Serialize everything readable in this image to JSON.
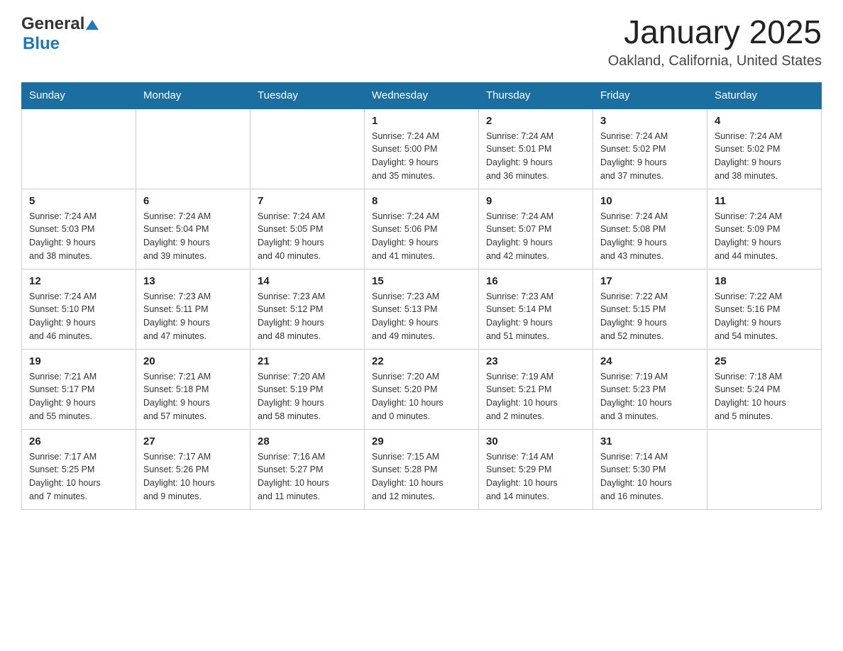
{
  "header": {
    "logo_general": "General",
    "logo_blue": "Blue",
    "title": "January 2025",
    "subtitle": "Oakland, California, United States"
  },
  "weekdays": [
    "Sunday",
    "Monday",
    "Tuesday",
    "Wednesday",
    "Thursday",
    "Friday",
    "Saturday"
  ],
  "weeks": [
    [
      {
        "day": "",
        "info": ""
      },
      {
        "day": "",
        "info": ""
      },
      {
        "day": "",
        "info": ""
      },
      {
        "day": "1",
        "info": "Sunrise: 7:24 AM\nSunset: 5:00 PM\nDaylight: 9 hours\nand 35 minutes."
      },
      {
        "day": "2",
        "info": "Sunrise: 7:24 AM\nSunset: 5:01 PM\nDaylight: 9 hours\nand 36 minutes."
      },
      {
        "day": "3",
        "info": "Sunrise: 7:24 AM\nSunset: 5:02 PM\nDaylight: 9 hours\nand 37 minutes."
      },
      {
        "day": "4",
        "info": "Sunrise: 7:24 AM\nSunset: 5:02 PM\nDaylight: 9 hours\nand 38 minutes."
      }
    ],
    [
      {
        "day": "5",
        "info": "Sunrise: 7:24 AM\nSunset: 5:03 PM\nDaylight: 9 hours\nand 38 minutes."
      },
      {
        "day": "6",
        "info": "Sunrise: 7:24 AM\nSunset: 5:04 PM\nDaylight: 9 hours\nand 39 minutes."
      },
      {
        "day": "7",
        "info": "Sunrise: 7:24 AM\nSunset: 5:05 PM\nDaylight: 9 hours\nand 40 minutes."
      },
      {
        "day": "8",
        "info": "Sunrise: 7:24 AM\nSunset: 5:06 PM\nDaylight: 9 hours\nand 41 minutes."
      },
      {
        "day": "9",
        "info": "Sunrise: 7:24 AM\nSunset: 5:07 PM\nDaylight: 9 hours\nand 42 minutes."
      },
      {
        "day": "10",
        "info": "Sunrise: 7:24 AM\nSunset: 5:08 PM\nDaylight: 9 hours\nand 43 minutes."
      },
      {
        "day": "11",
        "info": "Sunrise: 7:24 AM\nSunset: 5:09 PM\nDaylight: 9 hours\nand 44 minutes."
      }
    ],
    [
      {
        "day": "12",
        "info": "Sunrise: 7:24 AM\nSunset: 5:10 PM\nDaylight: 9 hours\nand 46 minutes."
      },
      {
        "day": "13",
        "info": "Sunrise: 7:23 AM\nSunset: 5:11 PM\nDaylight: 9 hours\nand 47 minutes."
      },
      {
        "day": "14",
        "info": "Sunrise: 7:23 AM\nSunset: 5:12 PM\nDaylight: 9 hours\nand 48 minutes."
      },
      {
        "day": "15",
        "info": "Sunrise: 7:23 AM\nSunset: 5:13 PM\nDaylight: 9 hours\nand 49 minutes."
      },
      {
        "day": "16",
        "info": "Sunrise: 7:23 AM\nSunset: 5:14 PM\nDaylight: 9 hours\nand 51 minutes."
      },
      {
        "day": "17",
        "info": "Sunrise: 7:22 AM\nSunset: 5:15 PM\nDaylight: 9 hours\nand 52 minutes."
      },
      {
        "day": "18",
        "info": "Sunrise: 7:22 AM\nSunset: 5:16 PM\nDaylight: 9 hours\nand 54 minutes."
      }
    ],
    [
      {
        "day": "19",
        "info": "Sunrise: 7:21 AM\nSunset: 5:17 PM\nDaylight: 9 hours\nand 55 minutes."
      },
      {
        "day": "20",
        "info": "Sunrise: 7:21 AM\nSunset: 5:18 PM\nDaylight: 9 hours\nand 57 minutes."
      },
      {
        "day": "21",
        "info": "Sunrise: 7:20 AM\nSunset: 5:19 PM\nDaylight: 9 hours\nand 58 minutes."
      },
      {
        "day": "22",
        "info": "Sunrise: 7:20 AM\nSunset: 5:20 PM\nDaylight: 10 hours\nand 0 minutes."
      },
      {
        "day": "23",
        "info": "Sunrise: 7:19 AM\nSunset: 5:21 PM\nDaylight: 10 hours\nand 2 minutes."
      },
      {
        "day": "24",
        "info": "Sunrise: 7:19 AM\nSunset: 5:23 PM\nDaylight: 10 hours\nand 3 minutes."
      },
      {
        "day": "25",
        "info": "Sunrise: 7:18 AM\nSunset: 5:24 PM\nDaylight: 10 hours\nand 5 minutes."
      }
    ],
    [
      {
        "day": "26",
        "info": "Sunrise: 7:17 AM\nSunset: 5:25 PM\nDaylight: 10 hours\nand 7 minutes."
      },
      {
        "day": "27",
        "info": "Sunrise: 7:17 AM\nSunset: 5:26 PM\nDaylight: 10 hours\nand 9 minutes."
      },
      {
        "day": "28",
        "info": "Sunrise: 7:16 AM\nSunset: 5:27 PM\nDaylight: 10 hours\nand 11 minutes."
      },
      {
        "day": "29",
        "info": "Sunrise: 7:15 AM\nSunset: 5:28 PM\nDaylight: 10 hours\nand 12 minutes."
      },
      {
        "day": "30",
        "info": "Sunrise: 7:14 AM\nSunset: 5:29 PM\nDaylight: 10 hours\nand 14 minutes."
      },
      {
        "day": "31",
        "info": "Sunrise: 7:14 AM\nSunset: 5:30 PM\nDaylight: 10 hours\nand 16 minutes."
      },
      {
        "day": "",
        "info": ""
      }
    ]
  ]
}
